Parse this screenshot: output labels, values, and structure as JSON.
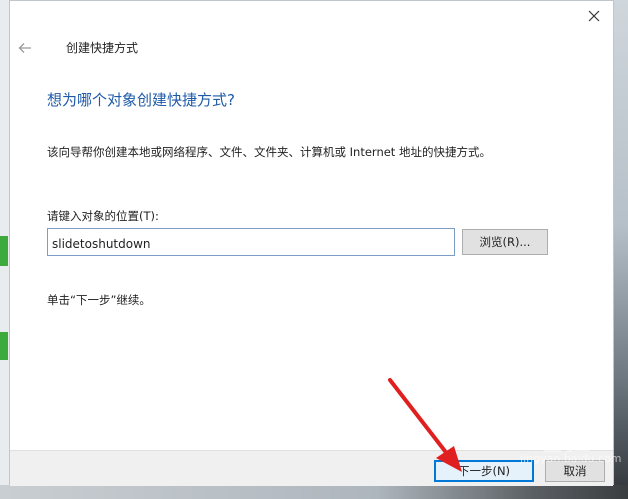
{
  "window": {
    "title": "创建快捷方式"
  },
  "main": {
    "heading": "想为哪个对象创建快捷方式?",
    "description": "该向导帮你创建本地或网络程序、文件、文件夹、计算机或 Internet 地址的快捷方式。",
    "location_label": "请键入对象的位置(T):",
    "location_value": "slidetoshutdown",
    "browse_label": "浏览(R)...",
    "hint": "单击“下一步”继续。"
  },
  "footer": {
    "next_label": "下一步(N)",
    "cancel_label": "取消"
  },
  "watermark": {
    "text": "Bai 经验",
    "sub": "jingyan.baidu.com"
  },
  "icons": [
    "back-arrow-icon",
    "close-icon"
  ],
  "colors": {
    "heading": "#1e5aa8",
    "annotation_arrow": "#e02020",
    "primary_button_border": "#0078d7"
  }
}
